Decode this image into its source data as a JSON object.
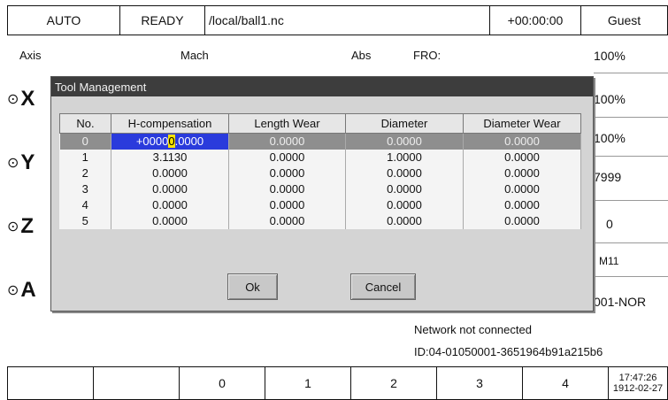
{
  "topbar": {
    "mode": "AUTO",
    "state": "READY",
    "file": "/local/ball1.nc",
    "timer": "+00:00:00",
    "user": "Guest"
  },
  "header": {
    "axis_label": "Axis",
    "mach_label": "Mach",
    "abs_label": "Abs",
    "fro_label": "FRO:"
  },
  "axes": [
    "X",
    "Y",
    "Z",
    "A"
  ],
  "right_values": [
    "100%",
    "100%",
    "100%",
    "7999",
    "0",
    "M11",
    "001-NOR"
  ],
  "dialog": {
    "title": "Tool Management",
    "columns": [
      "No.",
      "H-compensation",
      "Length Wear",
      "Diameter",
      "Diameter Wear"
    ],
    "rows": [
      [
        "0",
        "+0000",
        "0.0000",
        "0.0000",
        "0.0000"
      ],
      [
        "1",
        "3.1130",
        "0.0000",
        "1.0000",
        "0.0000"
      ],
      [
        "2",
        "0.0000",
        "0.0000",
        "0.0000",
        "0.0000"
      ],
      [
        "3",
        "0.0000",
        "0.0000",
        "0.0000",
        "0.0000"
      ],
      [
        "4",
        "0.0000",
        "0.0000",
        "0.0000",
        "0.0000"
      ],
      [
        "5",
        "0.0000",
        "0.0000",
        "0.0000",
        "0.0000"
      ]
    ],
    "edit_caret": "0",
    "edit_tail": ".0000",
    "ok_label": "Ok",
    "cancel_label": "Cancel"
  },
  "status": {
    "network": "Network not connected",
    "device_id": "ID:04-01050001-3651964b91a215b6"
  },
  "softkeys": [
    "",
    "",
    "0",
    "1",
    "2",
    "3",
    "4"
  ],
  "clock": {
    "time": "17:47:26",
    "date": "1912-02-27"
  },
  "colors": {
    "dialog_title_bg": "#3d3d3d",
    "selected_row_bg": "#8e8e8e",
    "edit_cell_bg": "#2a3bdc",
    "caret_bg": "#f7e300"
  }
}
